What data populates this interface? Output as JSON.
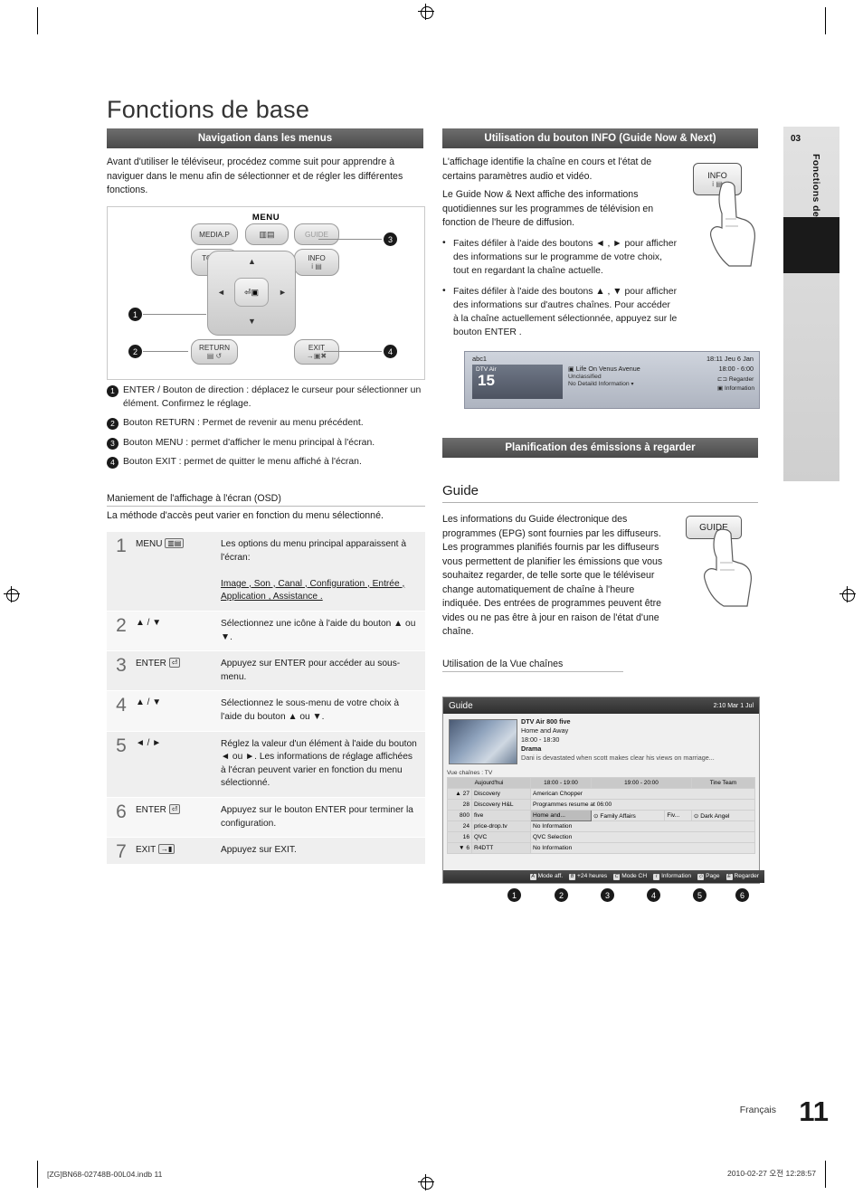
{
  "page": {
    "title": "Fonctions de base",
    "language": "Français",
    "number": "11",
    "footer_left": "[ZG]BN68-02748B-00L04.indb   11",
    "footer_right": "2010-02-27   오전 12:28:57",
    "tab": {
      "chapter": "03",
      "label": "Fonctions de base"
    }
  },
  "left": {
    "section_title": "Navigation dans les menus",
    "intro": "Avant d'utiliser le téléviseur, procédez comme suit pour apprendre à naviguer dans le menu afin de sélectionner et de régler les différentes fonctions.",
    "remote": {
      "menu_label": "MENU",
      "buttons": {
        "media": "MEDIA.P",
        "menu": "MENU",
        "guide": "GUIDE",
        "tools": "TOOLS",
        "info": "INFO",
        "return": "RETURN",
        "exit": "EXIT",
        "enter": "ENTER"
      },
      "callouts": [
        "1",
        "2",
        "3",
        "4"
      ]
    },
    "notes": [
      {
        "num": "1",
        "text": "ENTER  / Bouton de direction : déplacez le curseur pour sélectionner un élément. Confirmez le réglage."
      },
      {
        "num": "2",
        "text": "Bouton RETURN : Permet de revenir au menu précédent."
      },
      {
        "num": "3",
        "text": "Bouton MENU : permet d'afficher le menu principal à l'écran."
      },
      {
        "num": "4",
        "text": "Bouton EXIT : permet de quitter le menu affiché à l'écran."
      }
    ],
    "osd_heading": "Maniement de l'affichage à l'écran (OSD)",
    "osd_text": "La méthode d'accès peut varier en fonction du menu sélectionné.",
    "steps": [
      {
        "num": "1",
        "key": "MENU",
        "desc": "Les options du menu principal apparaissent à l'écran:",
        "desc2": "Image , Son , Canal , Configuration , Entrée , Application , Assistance ."
      },
      {
        "num": "2",
        "key": "▲ / ▼",
        "desc": "Sélectionnez une icône à l'aide du bouton ▲ ou ▼.",
        "desc2": ""
      },
      {
        "num": "3",
        "key": "ENTER",
        "desc": "Appuyez sur ENTER  pour accéder au sous-menu.",
        "desc2": ""
      },
      {
        "num": "4",
        "key": "▲ / ▼",
        "desc": "Sélectionnez le sous-menu de votre choix à l'aide du bouton ▲ ou ▼.",
        "desc2": ""
      },
      {
        "num": "5",
        "key": "◄ / ►",
        "desc": "Réglez la valeur d'un élément à l'aide du bouton ◄ ou ►. Les informations de réglage affichées à l'écran peuvent varier en fonction du menu sélectionné.",
        "desc2": ""
      },
      {
        "num": "6",
        "key": "ENTER",
        "desc": "Appuyez sur le bouton ENTER  pour terminer la configuration.",
        "desc2": ""
      },
      {
        "num": "7",
        "key": "EXIT",
        "desc": "Appuyez sur EXIT.",
        "desc2": ""
      }
    ]
  },
  "right": {
    "section_title_info": "Utilisation du bouton INFO (Guide Now & Next)",
    "info_p1": "L'affichage identifie la chaîne en cours et l'état de certains paramètres audio et vidéo.",
    "info_p2": "Le Guide Now & Next affiche des informations quotidiennes sur les programmes de télévision en fonction de l'heure de diffusion.",
    "info_button": {
      "label": "INFO",
      "sub": "i"
    },
    "bullets": [
      "Faites défiler à l'aide des boutons ◄ , ► pour afficher des informations sur le programme de votre choix, tout en regardant la chaîne actuelle.",
      "Faites défiler à l'aide des boutons ▲ , ▼ pour afficher des informations sur d'autres chaînes. Pour accéder à la chaîne actuellement sélectionnée, appuyez sur le bouton ENTER  ."
    ],
    "info_osd": {
      "channel_name": "abc1",
      "datetime": "18:11 Jeu 6 Jan",
      "source": "DTV Air",
      "number": "15",
      "program": "Life On Venus Avenue",
      "time": "18:00 - 6:00",
      "rating": "Unclassified",
      "detail": "No Detaild Information",
      "keys": [
        "Regarder",
        "Information"
      ]
    },
    "section_title_plan": "Planification des émissions à regarder",
    "guide_heading": "Guide",
    "guide_text": "Les informations du Guide électronique des programmes (EPG) sont fournies par les diffuseurs. Les programmes planifiés fournis par les diffuseurs vous permettent de planifier les émissions que vous souhaitez regarder, de telle sorte que le téléviseur change automatiquement de chaîne à l'heure indiquée. Des entrées de programmes peuvent être vides ou ne pas être à jour en raison de l'état d'une chaîne.",
    "guide_button": {
      "label": "GUIDE"
    },
    "vue_heading": "Utilisation de la Vue chaînes",
    "guide_osd": {
      "title": "Guide",
      "clock": "2:10 Mar 1 Jul",
      "meta": {
        "channel": "DTV Air 800 five",
        "program": "Home and Away",
        "time": "18:00 - 18:30",
        "genre": "Drama",
        "desc": "Dani is devastated when scott makes clear his views on marriage..."
      },
      "view_label": "Vue chaînes : TV",
      "time_headers": [
        "Aujourd'hui",
        "18:00 - 19:00",
        "19:00 - 20:00"
      ],
      "time_extra": "Tine Team",
      "rows": [
        {
          "ch": "27",
          "name": "Discovery",
          "cells": [
            "American Chopper",
            ""
          ]
        },
        {
          "ch": "28",
          "name": "Discovery H&L",
          "cells": [
            "Programmes resume at 06:00",
            ""
          ]
        },
        {
          "ch": "800",
          "name": "five",
          "cells": [
            "Home and...",
            "Family Affairs",
            "Fiv...",
            "Dark Angel"
          ]
        },
        {
          "ch": "24",
          "name": "price-drop.tv",
          "cells": [
            "No Information",
            ""
          ]
        },
        {
          "ch": "16",
          "name": "QVC",
          "cells": [
            "QVC Selection",
            ""
          ]
        },
        {
          "ch": "6",
          "name": "R4DTT",
          "cells": [
            "No Information",
            ""
          ]
        }
      ],
      "footer_keys": [
        {
          "key": "A",
          "label": "Mode aff."
        },
        {
          "key": "B",
          "label": "+24 heures"
        },
        {
          "key": "C",
          "label": "Mode CH"
        },
        {
          "key": "i",
          "label": "Information"
        },
        {
          "key": "◇",
          "label": "Page"
        },
        {
          "key": "E",
          "label": "Regarder"
        }
      ],
      "callouts": [
        "1",
        "2",
        "3",
        "4",
        "5",
        "6"
      ]
    }
  }
}
